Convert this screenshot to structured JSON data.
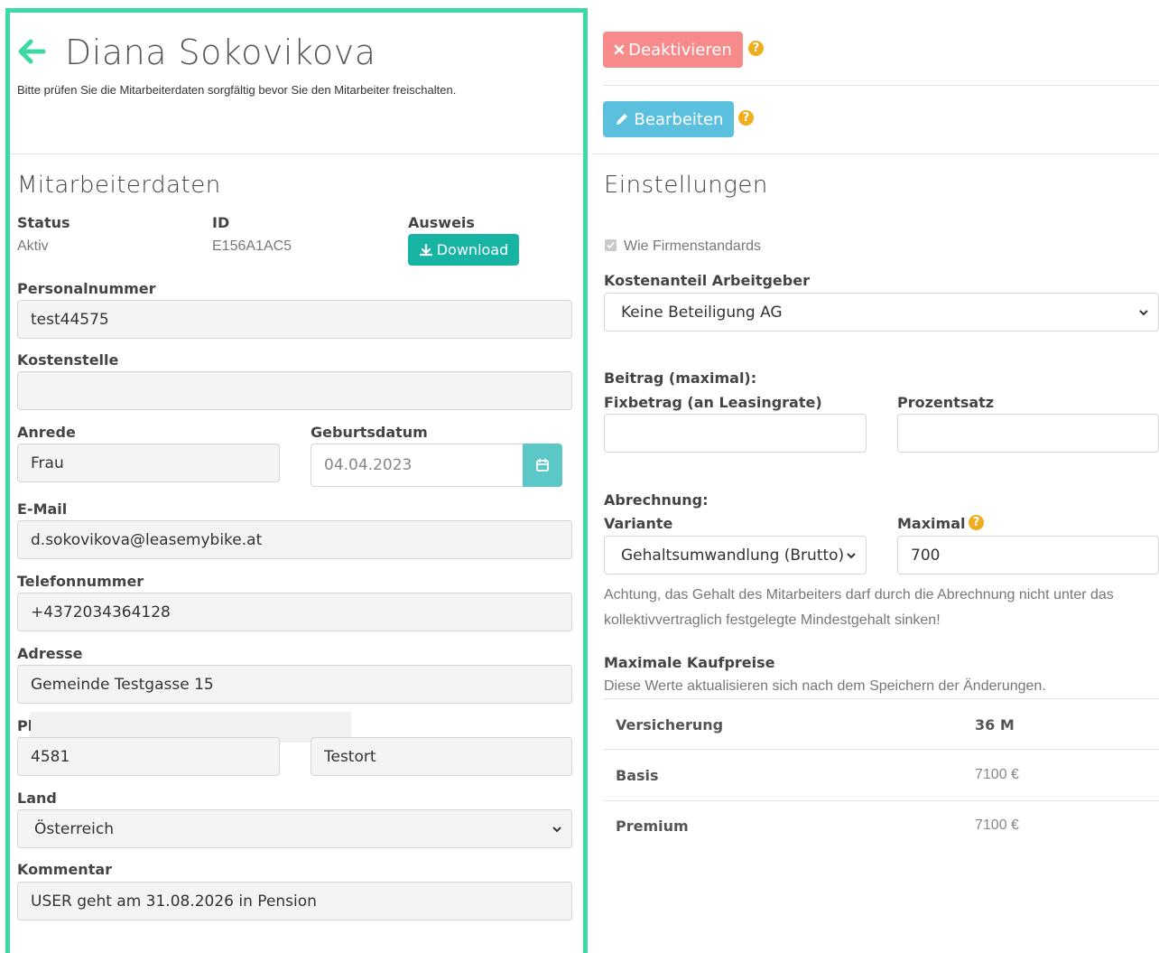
{
  "header": {
    "title": "Diana Sokovikova",
    "subtitle": "Bitte prüfen Sie die Mitarbeiterdaten sorgfältig bevor Sie den Mitarbeiter freischalten."
  },
  "employee": {
    "section_title": "Mitarbeiterdaten",
    "status_label": "Status",
    "status_value": "Aktiv",
    "id_label": "ID",
    "id_value": "E156A1AC5",
    "ausweis_label": "Ausweis",
    "download_label": "Download",
    "personalnummer_label": "Personalnummer",
    "personalnummer_value": "test44575",
    "kostenstelle_label": "Kostenstelle",
    "kostenstelle_value": "",
    "anrede_label": "Anrede",
    "anrede_value": "Frau",
    "geburtsdatum_label": "Geburtsdatum",
    "geburtsdatum_value": "04.04.2023",
    "email_label": "E-Mail",
    "email_value": "d.sokovikova@leasemybike.at",
    "telefon_label": "Telefonnummer",
    "telefon_value": "+4372034364128",
    "adresse_label": "Adresse",
    "adresse_value": "Gemeinde Testgasse 15",
    "plz_label_partial": "Pl",
    "plz_value": "4581",
    "ort_value": "Testort",
    "land_label": "Land",
    "land_value": "Österreich",
    "kommentar_label": "Kommentar",
    "kommentar_value": "USER geht am 31.08.2026 in Pension"
  },
  "actions": {
    "deactivate_label": "Deaktivieren",
    "edit_label": "Bearbeiten",
    "help_glyph": "?"
  },
  "settings": {
    "section_title": "Einstellungen",
    "checkbox_label": "Wie Firmenstandards",
    "kostenanteil_label": "Kostenanteil Arbeitgeber",
    "kostenanteil_value": "Keine Beteiligung AG",
    "beitrag_heading": "Beitrag (maximal):",
    "fixbetrag_label": "Fixbetrag (an Leasingrate)",
    "fixbetrag_value": "",
    "prozentsatz_label": "Prozentsatz",
    "prozentsatz_value": "",
    "abrechnung_heading": "Abrechnung:",
    "variante_label": "Variante",
    "variante_value": "Gehaltsumwandlung (Brutto)",
    "maximal_label": "Maximal",
    "maximal_value": "700",
    "warning_line1": "Achtung, das Gehalt des Mitarbeiters darf durch die Abrechnung nicht unter das",
    "warning_line2": "kollektivvertraglich festgelegte Mindestgehalt sinken!",
    "kaufpreise_heading": "Maximale Kaufpreise",
    "kaufpreise_note": "Diese Werte aktualisieren sich nach dem Speichern der Änderungen.",
    "table": [
      {
        "label": "Versicherung",
        "value": "36 M"
      },
      {
        "label": "Basis",
        "value": "7100 €"
      },
      {
        "label": "Premium",
        "value": "7100 €"
      }
    ]
  },
  "colors": {
    "frame": "#3dd9a4",
    "download": "#17b3a3",
    "deactivate": "#f78a8a",
    "edit": "#5bc0de",
    "help": "#f0ad1e"
  }
}
